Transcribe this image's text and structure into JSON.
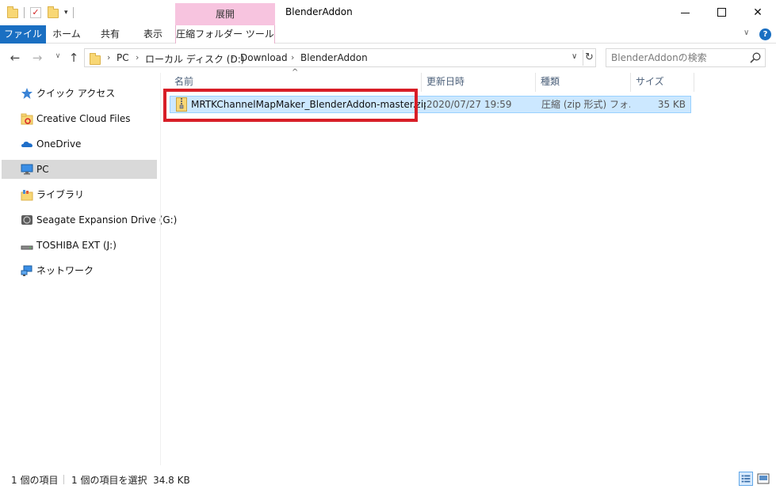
{
  "window": {
    "title": "BlenderAddon",
    "context_tab_group": "展開",
    "controls": {
      "minimize_icon": "minimize-icon",
      "maximize_icon": "maximize-icon",
      "close_icon": "close-icon",
      "close_glyph": "✕"
    }
  },
  "quick_access_toolbar": {
    "items": [
      "folder-icon",
      "properties-icon",
      "new-folder-icon"
    ],
    "dropdown_glyph": "▾"
  },
  "ribbon": {
    "tabs": [
      {
        "label": "ファイル",
        "active": true
      },
      {
        "label": "ホーム"
      },
      {
        "label": "共有"
      },
      {
        "label": "表示"
      },
      {
        "label": "圧縮フォルダー ツール",
        "contextual": true
      }
    ],
    "expand_glyph": "∨",
    "help_glyph": "?"
  },
  "navigation": {
    "back_glyph": "←",
    "forward_glyph": "→",
    "recent_glyph": "∨",
    "up_glyph": "↑"
  },
  "address_bar": {
    "breadcrumbs": [
      "PC",
      "ローカル ディスク (D:)",
      "Download",
      "BlenderAddon"
    ],
    "separator": "›",
    "dropdown_glyph": "∨",
    "refresh_glyph": "↻"
  },
  "search": {
    "placeholder": "BlenderAddonの検索"
  },
  "nav_pane": {
    "items": [
      {
        "label": "クイック アクセス",
        "icon": "star-icon"
      },
      {
        "label": "Creative Cloud Files",
        "icon": "creative-cloud-folder-icon"
      },
      {
        "label": "OneDrive",
        "icon": "onedrive-cloud-icon"
      },
      {
        "label": "PC",
        "icon": "pc-monitor-icon",
        "selected": true
      },
      {
        "label": "ライブラリ",
        "icon": "library-icon"
      },
      {
        "label": "Seagate Expansion Drive (G:)",
        "icon": "seagate-drive-icon"
      },
      {
        "label": "TOSHIBA EXT (J:)",
        "icon": "external-drive-icon"
      },
      {
        "label": "ネットワーク",
        "icon": "network-icon"
      }
    ]
  },
  "file_list": {
    "sort_indicator": "^",
    "columns": [
      "名前",
      "更新日時",
      "種類",
      "サイズ"
    ],
    "rows": [
      {
        "name": "MRTKChannelMapMaker_BlenderAddon-master.zip",
        "modified": "2020/07/27 19:59",
        "type": "圧縮 (zip 形式) フォ...",
        "size": "35 KB",
        "icon": "zip-folder-icon",
        "selected": true
      }
    ]
  },
  "status_bar": {
    "item_count": "1 個の項目",
    "selection": "1 個の項目を選択  34.8 KB",
    "view_buttons": [
      "details-view-icon",
      "large-icons-view-icon"
    ]
  },
  "colors": {
    "file_tab": "#1a6fc2",
    "context_tab": "#f7c4df",
    "selection_fill": "#cce8ff",
    "selection_border": "#99d1ff",
    "highlight": "#d81e27",
    "nav_selected": "#d9d9d9"
  }
}
